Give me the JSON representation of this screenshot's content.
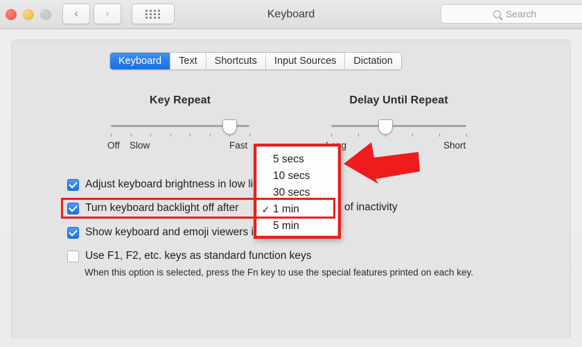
{
  "window": {
    "title": "Keyboard",
    "traffic_lights": [
      "close",
      "minimize",
      "zoom"
    ],
    "nav": {
      "back": "‹",
      "forward": "›"
    },
    "grid_button": "show-all-icon"
  },
  "search": {
    "placeholder": "Search",
    "icon": "search-icon"
  },
  "tabs": [
    {
      "label": "Keyboard",
      "active": true
    },
    {
      "label": "Text",
      "active": false
    },
    {
      "label": "Shortcuts",
      "active": false
    },
    {
      "label": "Input Sources",
      "active": false
    },
    {
      "label": "Dictation",
      "active": false
    }
  ],
  "sliders": {
    "key_repeat": {
      "title": "Key Repeat",
      "left_label": "Off",
      "second_label": "Slow",
      "right_label": "Fast",
      "ticks": 8,
      "value_index": 7
    },
    "delay_until_repeat": {
      "title": "Delay Until Repeat",
      "left_label": "Long",
      "right_label": "Short",
      "ticks": 6,
      "value_index": 3
    }
  },
  "checkboxes": [
    {
      "label": "Adjust keyboard brightness in low light",
      "checked": true
    },
    {
      "label": "Turn keyboard backlight off after",
      "checked": true
    },
    {
      "label": "Show keyboard and emoji viewers in menu bar",
      "checked": true
    },
    {
      "label": "Use F1, F2, etc. keys as standard function keys",
      "checked": false
    }
  ],
  "backlight_row": {
    "trailing_text": "of inactivity",
    "selected_value": "1 min"
  },
  "hint_text": "When this option is selected, press the Fn key to use the special features printed on each key.",
  "dropdown": {
    "items": [
      {
        "label": "5 secs",
        "checked": false
      },
      {
        "label": "10 secs",
        "checked": false
      },
      {
        "label": "30 secs",
        "checked": false
      },
      {
        "label": "1 min",
        "checked": true
      },
      {
        "label": "5 min",
        "checked": false
      }
    ],
    "check_glyph": "✓"
  },
  "annotations": {
    "arrow": "red-left-arrow",
    "highlight": "red-highlight-box"
  },
  "colors": {
    "accent_blue": "#1a73e8",
    "annotation_red": "#ee1c1c",
    "panel_gray": "#e4e4e4"
  }
}
